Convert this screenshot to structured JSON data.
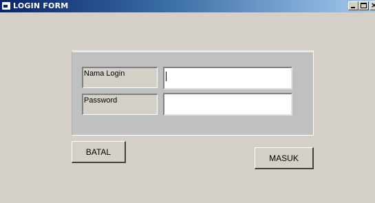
{
  "window": {
    "title": "LOGIN FORM",
    "minimize_glyph": "_",
    "close_glyph": "×"
  },
  "form": {
    "login_label": "Nama Login",
    "password_label": "Password",
    "login_value": "",
    "password_value": ""
  },
  "buttons": {
    "cancel_label": "BATAL",
    "submit_label": "MASUK"
  },
  "colors": {
    "titlebar_start": "#0a246a",
    "titlebar_end": "#a6caf0",
    "face": "#d4d0c8",
    "group": "#c0c0c0"
  },
  "icons": [
    "app-window-icon",
    "minimize-icon",
    "maximize-icon",
    "close-icon"
  ]
}
